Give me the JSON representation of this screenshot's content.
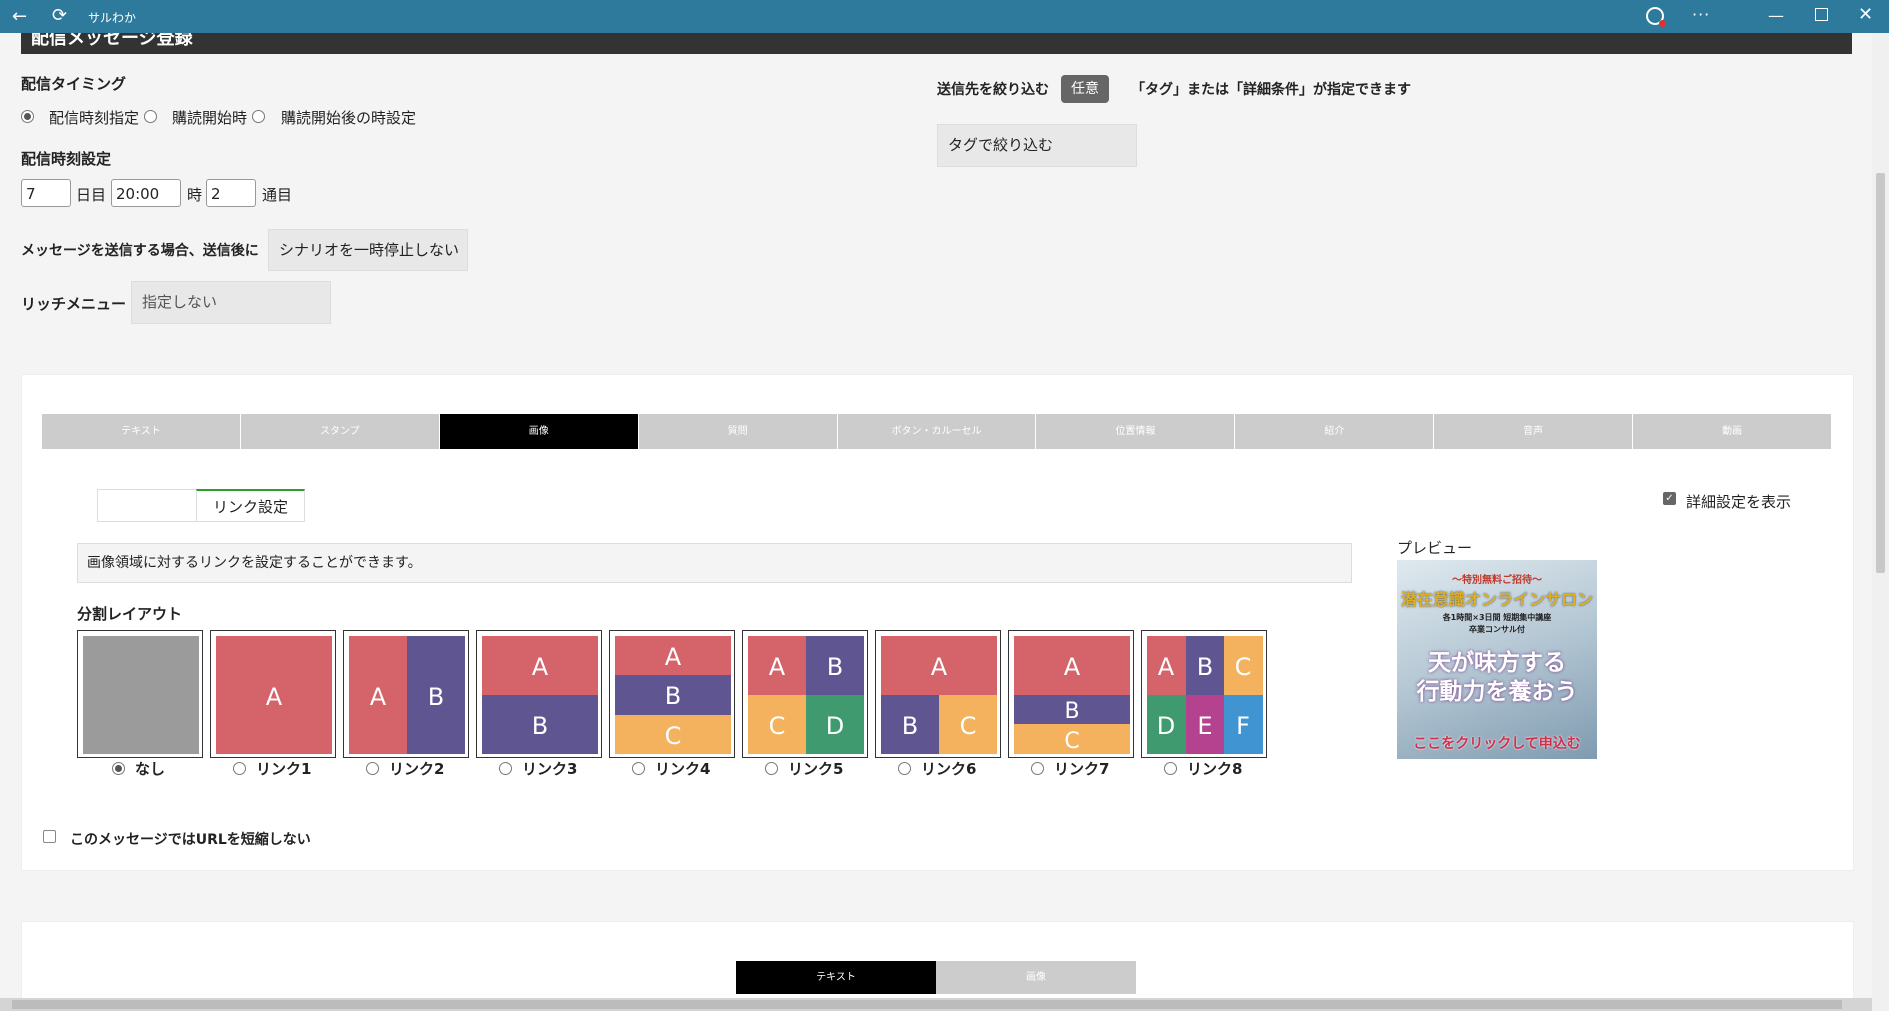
{
  "window": {
    "title": "サルわか"
  },
  "header": {
    "title": "配信メッセージ登録"
  },
  "timing": {
    "heading": "配信タイミング",
    "options": [
      "配信時刻指定",
      "購読開始時",
      "購読開始後の時設定"
    ],
    "selected": "配信時刻指定"
  },
  "time_setting": {
    "heading": "配信時刻設定",
    "day_value": "7",
    "day_unit": "日目",
    "time_value": "20:00",
    "time_unit": "時",
    "count_value": "2",
    "count_unit": "通目"
  },
  "after_send": {
    "label": "メッセージを送信する場合、送信後に",
    "value": "シナリオを一時停止しない"
  },
  "rich_menu": {
    "label": "リッチメニュー",
    "value": "指定しない"
  },
  "filter": {
    "label": "送信先を絞り込む",
    "badge": "任意",
    "note": "「タグ」または「詳細条件」が指定できます",
    "tag_button": "タグで絞り込む"
  },
  "message_tabs": [
    "テキスト",
    "スタンプ",
    "画像",
    "質問",
    "ボタン・カルーセル",
    "位置情報",
    "紹介",
    "音声",
    "動画"
  ],
  "active_message_tab": "画像",
  "sub_tabs": [
    "",
    "リンク設定"
  ],
  "active_sub_tab": "リンク設定",
  "detail_setting": {
    "label": "詳細設定を表示",
    "checked": true
  },
  "info_text": "画像領域に対するリンクを設定することができます。",
  "split_layout": {
    "heading": "分割レイアウト",
    "options": [
      "なし",
      "リンク1",
      "リンク2",
      "リンク3",
      "リンク4",
      "リンク5",
      "リンク6",
      "リンク7",
      "リンク8"
    ],
    "selected": "なし"
  },
  "preview": {
    "label": "プレビュー",
    "line1": "〜特別無料ご招待〜",
    "line2": "潜在意識オンラインサロン",
    "line3": "各1時間×3日間 短期集中講座",
    "line4": "卒業コンサル付",
    "line5": "天が味方する",
    "line6": "行動力を養おう",
    "line7": "ここをクリックして申込む"
  },
  "url_shorten": {
    "label": "このメッセージではURLを短縮しない",
    "checked": false
  },
  "bottom_tabs": [
    "テキスト",
    "画像"
  ],
  "colors": {
    "red": "#d4636a",
    "purple": "#5f5590",
    "orange": "#f4b25e",
    "green": "#3f9a6f",
    "magenta": "#b5428e",
    "blue": "#3f94d1",
    "gray": "#9b9b9b"
  }
}
